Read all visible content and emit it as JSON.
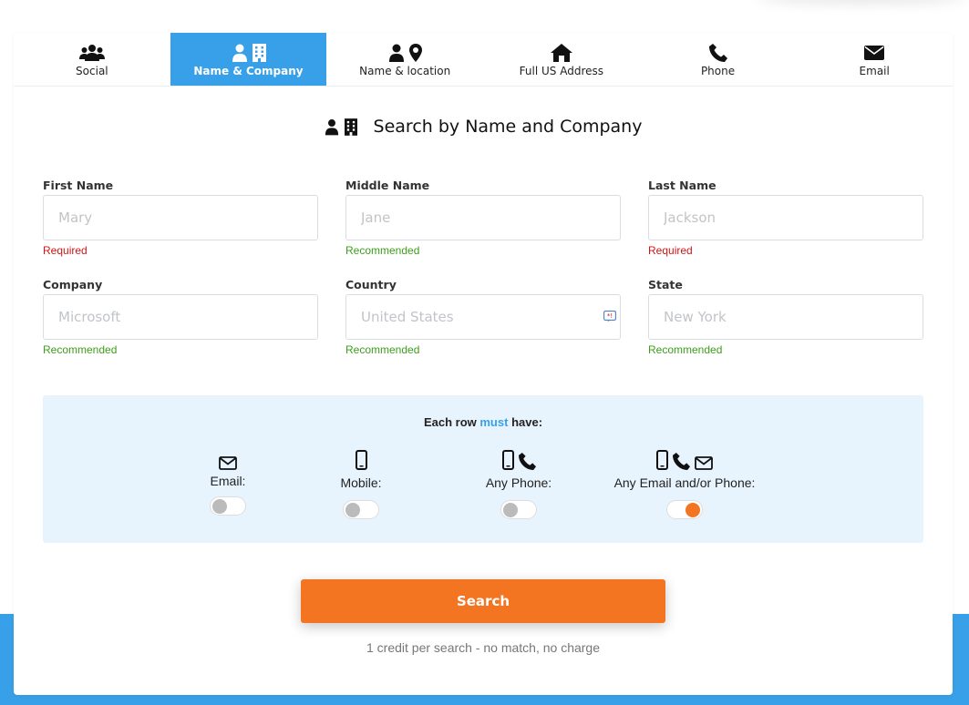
{
  "tabs": [
    {
      "label": "Social",
      "icon": "users-icon"
    },
    {
      "label": "Name & Company",
      "icon": "user-building-icon"
    },
    {
      "label": "Name & location",
      "icon": "user-location-icon"
    },
    {
      "label": "Full US Address",
      "icon": "home-icon"
    },
    {
      "label": "Phone",
      "icon": "phone-icon"
    },
    {
      "label": "Email",
      "icon": "envelope-icon"
    }
  ],
  "active_tab": "Name & Company",
  "title": "Search by Name and Company",
  "fields": {
    "first_name": {
      "label": "First Name",
      "placeholder": "Mary",
      "hint": "Required"
    },
    "middle_name": {
      "label": "Middle Name",
      "placeholder": "Jane",
      "hint": "Recommended"
    },
    "last_name": {
      "label": "Last Name",
      "placeholder": "Jackson",
      "hint": "Required"
    },
    "company": {
      "label": "Company",
      "placeholder": "Microsoft",
      "hint": "Recommended"
    },
    "country": {
      "label": "Country",
      "placeholder": "United States",
      "hint": "Recommended"
    },
    "state": {
      "label": "State",
      "placeholder": "New York",
      "hint": "Recommended"
    }
  },
  "filter": {
    "prefix": "Each row",
    "must": "must",
    "suffix": "have:",
    "options": [
      {
        "label": "Email:",
        "on": false
      },
      {
        "label": "Mobile:",
        "on": false
      },
      {
        "label": "Any Phone:",
        "on": false
      },
      {
        "label": "Any Email and/or Phone:",
        "on": true
      }
    ]
  },
  "search_button": "Search",
  "note": "1 credit per search - no match, no charge",
  "colors": {
    "accent": "#38a0e8",
    "button": "#f47521",
    "required": "#d01515",
    "recommended": "#3d9d1c",
    "filter_bg": "#e8f4fd"
  }
}
